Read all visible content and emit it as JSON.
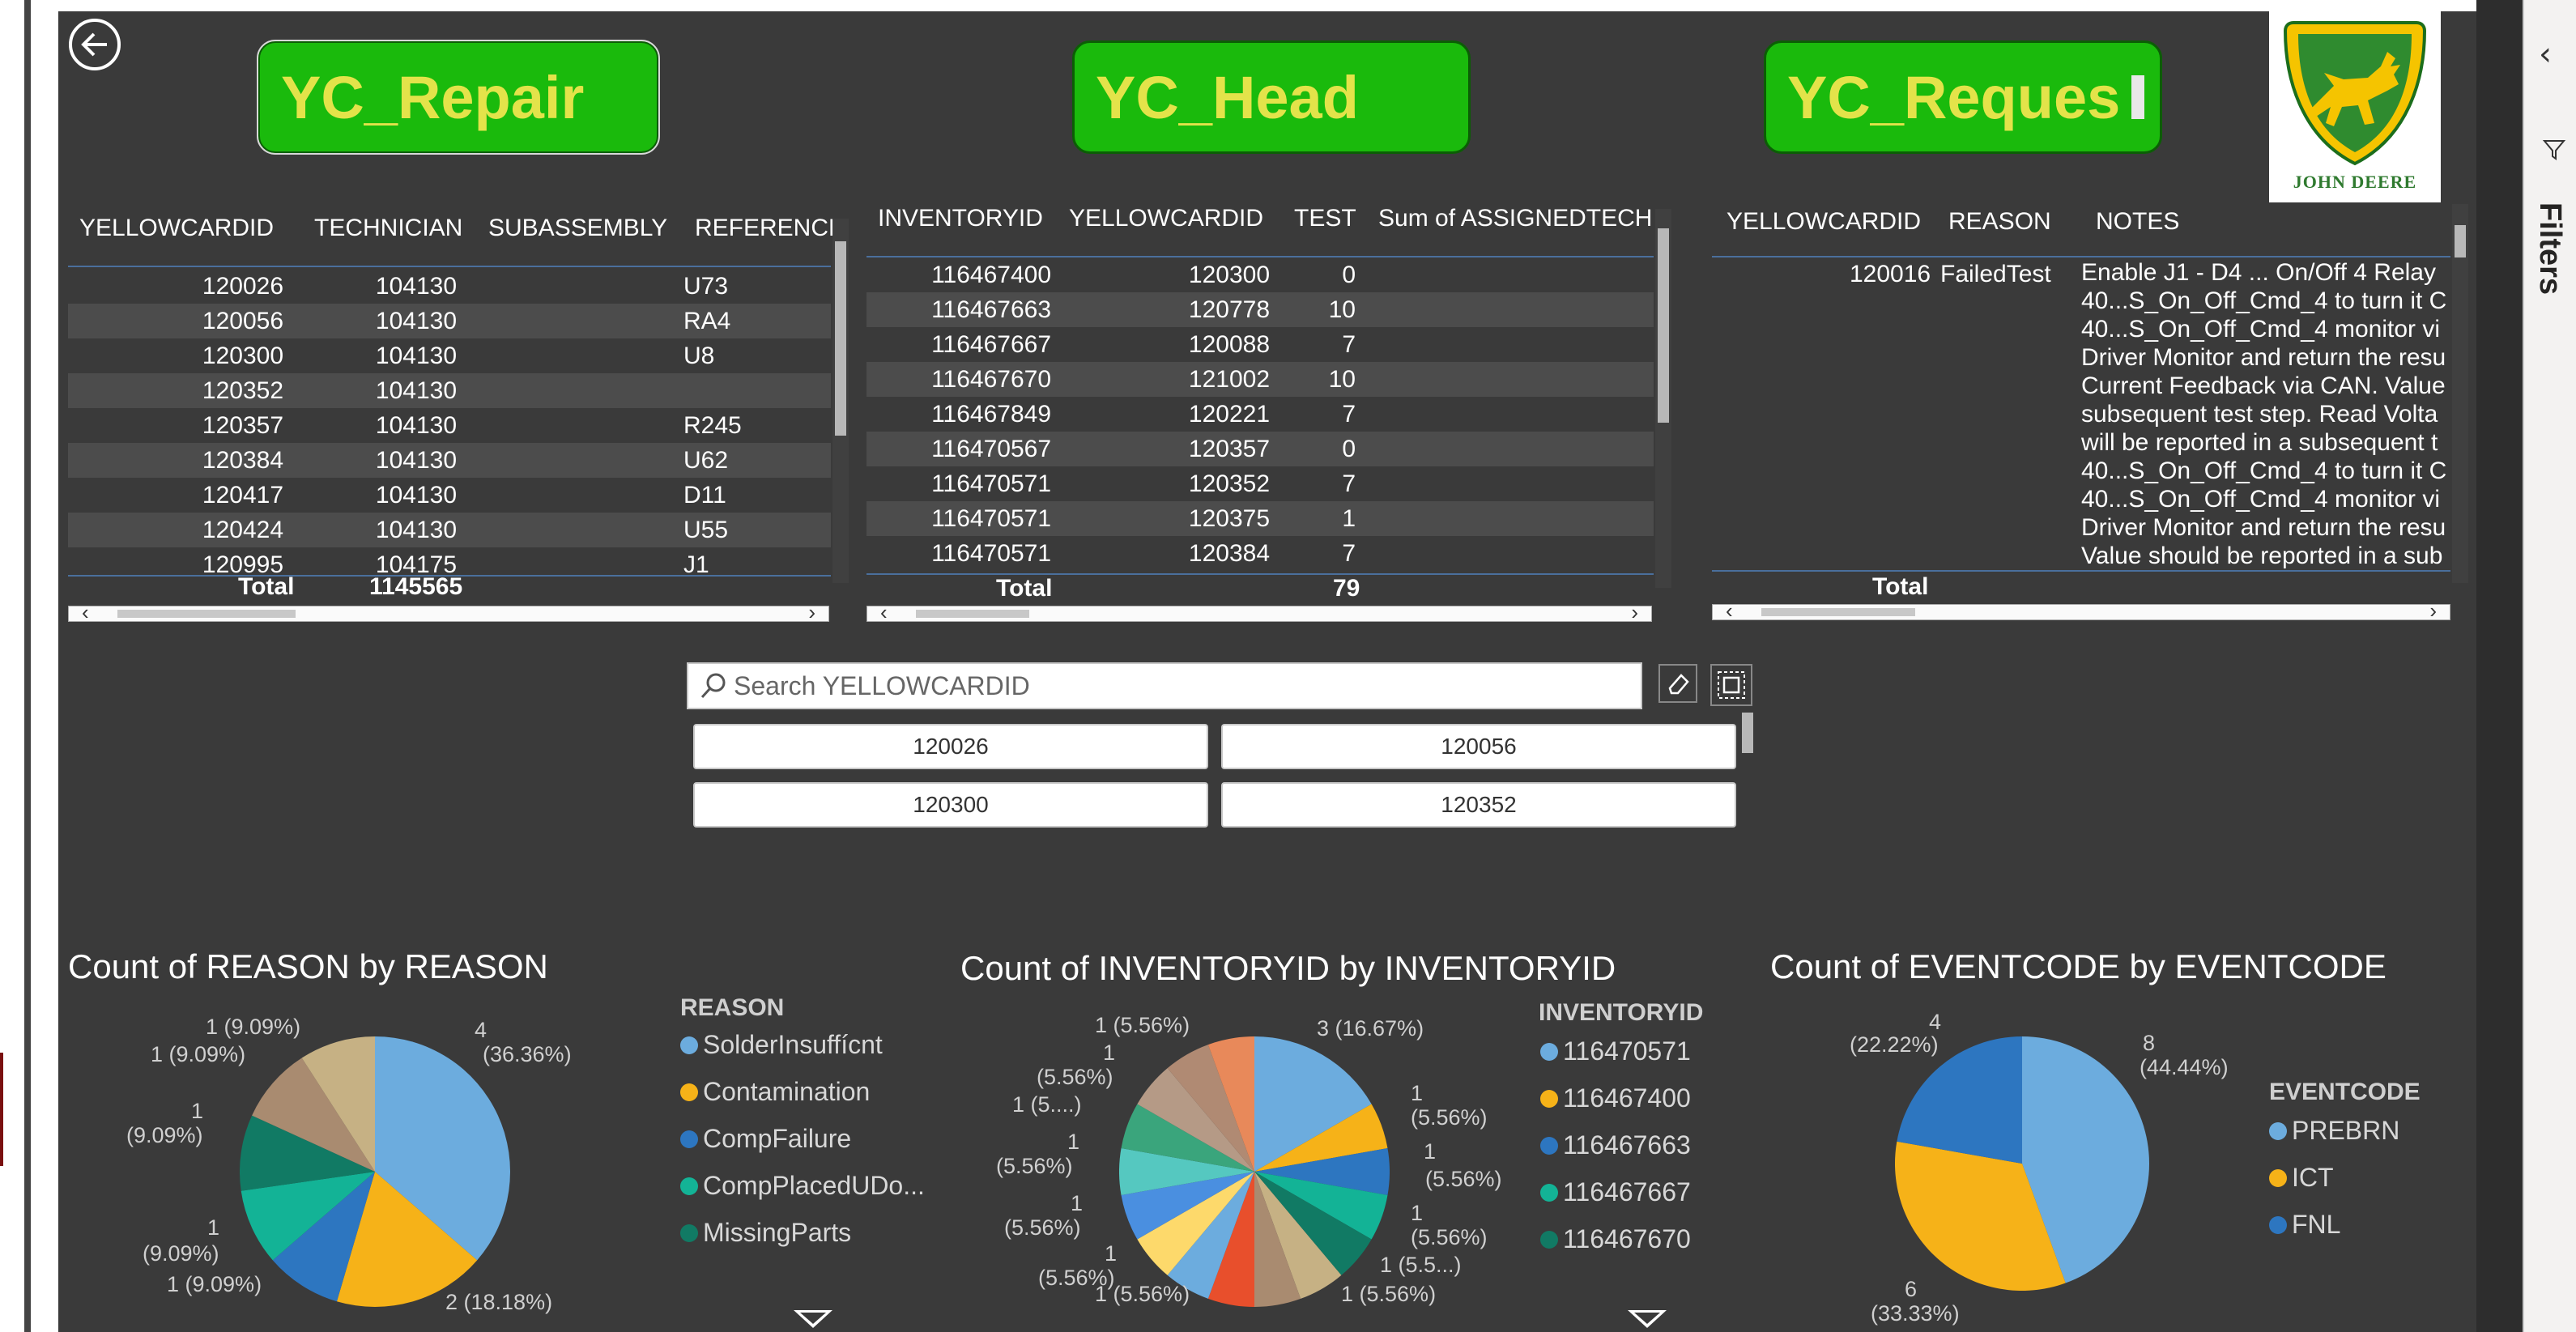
{
  "colors": {
    "canvas": "#3a3a3a",
    "button_fill": "#1aba0c",
    "button_text": "#e3e34a",
    "row_alt": "#4c4c4c",
    "separator": "#4a6f9c"
  },
  "buttons": {
    "repair": "YC_Repair",
    "head": "YC_Head",
    "request": "YC_Reques"
  },
  "logo": {
    "wordmark": "JOHN DEERE"
  },
  "filters_pane": {
    "label": "Filters"
  },
  "table_repair": {
    "columns": [
      "YELLOWCARDID",
      "TECHNICIAN",
      "SUBASSEMBLY",
      "REFERENCE"
    ],
    "rows": [
      [
        "120026",
        "104130",
        "",
        "U73"
      ],
      [
        "120056",
        "104130",
        "",
        "RA4"
      ],
      [
        "120300",
        "104130",
        "",
        "U8"
      ],
      [
        "120352",
        "104130",
        "",
        ""
      ],
      [
        "120357",
        "104130",
        "",
        "R245"
      ],
      [
        "120384",
        "104130",
        "",
        "U62"
      ],
      [
        "120417",
        "104130",
        "",
        "D11"
      ],
      [
        "120424",
        "104130",
        "",
        "U55"
      ],
      [
        "120995",
        "104175",
        "",
        "J1"
      ]
    ],
    "total_label": "Total",
    "total_value": "1145565"
  },
  "table_head": {
    "columns": [
      "INVENTORYID",
      "YELLOWCARDID",
      "TEST",
      "Sum of ASSIGNEDTECH"
    ],
    "rows": [
      [
        "116467400",
        "120300",
        "0",
        ""
      ],
      [
        "116467663",
        "120778",
        "10",
        ""
      ],
      [
        "116467667",
        "120088",
        "7",
        ""
      ],
      [
        "116467670",
        "121002",
        "10",
        ""
      ],
      [
        "116467849",
        "120221",
        "7",
        ""
      ],
      [
        "116470567",
        "120357",
        "0",
        ""
      ],
      [
        "116470571",
        "120352",
        "7",
        ""
      ],
      [
        "116470571",
        "120375",
        "1",
        ""
      ],
      [
        "116470571",
        "120384",
        "7",
        ""
      ]
    ],
    "total_label": "Total",
    "total_value": "79"
  },
  "table_request": {
    "columns": [
      "YELLOWCARDID",
      "REASON",
      "NOTES"
    ],
    "row_id": "120016",
    "row_reason": "FailedTest",
    "notes_lines": [
      "Enable J1 - D4 ... On/Off 4 Relay",
      "40...S_On_Off_Cmd_4 to turn it C",
      "40...S_On_Off_Cmd_4 monitor vi",
      "Driver Monitor and return the resu",
      "Current Feedback via CAN. Value",
      "subsequent test step. Read Volta",
      "will be reported in a subsequent t",
      "40...S_On_Off_Cmd_4 to turn it C",
      "40...S_On_Off_Cmd_4 monitor vi",
      "Driver Monitor and return the resu",
      "Value should be reported in a sub"
    ],
    "total_label": "Total"
  },
  "slicer": {
    "placeholder": "Search YELLOWCARDID",
    "options": [
      "120026",
      "120056",
      "120300",
      "120352"
    ]
  },
  "charts": [
    {
      "title": "Count of REASON by REASON",
      "legend_title": "REASON",
      "legend": [
        {
          "name": "SolderInsuffícnt",
          "color": "#6cacde"
        },
        {
          "name": "Contamination",
          "color": "#f6b218"
        },
        {
          "name": "CompFailure",
          "color": "#2d76c0"
        },
        {
          "name": "CompPlacedUDo...",
          "color": "#13b396"
        },
        {
          "name": "MissingParts",
          "color": "#117a64"
        }
      ],
      "labels": [
        "4",
        "(36.36%)",
        "2 (18.18%)",
        "1 (9.09%)",
        "1",
        "(9.09%)",
        "1",
        "(9.09%)",
        "1 (9.09%)",
        "1 (9.09%)"
      ]
    },
    {
      "title": "Count of INVENTORYID by INVENTORYID",
      "legend_title": "INVENTORYID",
      "legend": [
        {
          "name": "116470571",
          "color": "#6cacde"
        },
        {
          "name": "116467400",
          "color": "#f6b218"
        },
        {
          "name": "116467663",
          "color": "#2d76c0"
        },
        {
          "name": "116467667",
          "color": "#13b396"
        },
        {
          "name": "116467670",
          "color": "#117a64"
        }
      ],
      "labels": [
        "3 (16.67%)",
        "1",
        "(5.56%)",
        "1",
        "(5.56%)",
        "1",
        "(5.56%)",
        "1 (5.5...)",
        "1 (5.56%)",
        "1 (5.56%)",
        "1",
        "(5.56%)",
        "1",
        "(5.56%)",
        "1",
        "(5.56%)",
        "1 (5....)",
        "1",
        "(5.56%)",
        "1 (5.56%)"
      ]
    },
    {
      "title": "Count of EVENTCODE by EVENTCODE",
      "legend_title": "EVENTCODE",
      "legend": [
        {
          "name": "PREBRN",
          "color": "#6cacde"
        },
        {
          "name": "ICT",
          "color": "#f6b218"
        },
        {
          "name": "FNL",
          "color": "#2d76c0"
        }
      ],
      "labels": [
        "8",
        "(44.44%)",
        "6",
        "(33.33%)",
        "4",
        "(22.22%)"
      ]
    }
  ],
  "chart_data": [
    {
      "type": "pie",
      "title": "Count of REASON by REASON",
      "categories": [
        "SolderInsuffícnt",
        "Contamination",
        "CompFailure",
        "CompPlacedUDo...",
        "MissingParts",
        "",
        ""
      ],
      "values": [
        4,
        2,
        1,
        1,
        1,
        1,
        1
      ],
      "colors": [
        "#6cacde",
        "#f6b218",
        "#2d76c0",
        "#13b396",
        "#117a64",
        "#a98b70",
        "#c6b184"
      ]
    },
    {
      "type": "pie",
      "title": "Count of INVENTORYID by INVENTORYID",
      "categories": [
        "116470571",
        "116467400",
        "116467663",
        "116467667",
        "116467670",
        "",
        "",
        "",
        "",
        "",
        "",
        "",
        "",
        "",
        "",
        ""
      ],
      "values": [
        3,
        1,
        1,
        1,
        1,
        1,
        1,
        1,
        1,
        1,
        1,
        1,
        1,
        1,
        1,
        1
      ],
      "colors": [
        "#6cacde",
        "#f6b218",
        "#2d76c0",
        "#13b396",
        "#117a64",
        "#c6b184",
        "#a98b70",
        "#e84f2c",
        "#6cacde",
        "#fdd96b",
        "#4a8fe0",
        "#55c8c0",
        "#3aa57c",
        "#b59a86",
        "#b08a73",
        "#e8895a"
      ]
    },
    {
      "type": "pie",
      "title": "Count of EVENTCODE by EVENTCODE",
      "categories": [
        "PREBRN",
        "ICT",
        "FNL"
      ],
      "values": [
        8,
        6,
        4
      ],
      "colors": [
        "#6cacde",
        "#f6b218",
        "#2d76c0"
      ]
    }
  ]
}
